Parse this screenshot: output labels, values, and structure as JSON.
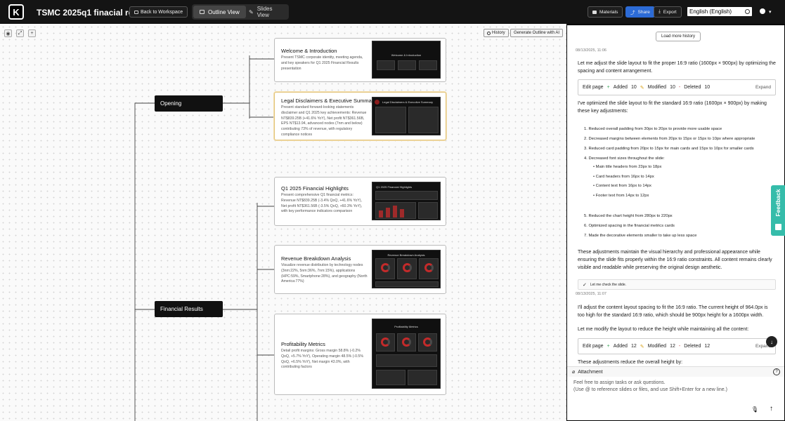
{
  "header": {
    "logo": "K",
    "title": "TSMC 2025q1 finacial report case",
    "back_label": "Back to Workspace",
    "outline_view": "Outline View",
    "slides_view": "Slides View",
    "materials": "Materials",
    "share": "Share",
    "export": "Export",
    "language": "English (English)"
  },
  "canvas": {
    "history": "History",
    "generate": "Generate Outline with AI",
    "sections": [
      {
        "label": "Opening"
      },
      {
        "label": "Financial Results"
      }
    ],
    "cards": [
      {
        "title": "Welcome & Introduction",
        "desc": "Present TSMC corporate identity, meeting agenda, and key speakers for Q1 2025 Financial Results presentation",
        "thumb_title": "Welcome & Introduction"
      },
      {
        "title": "Legal Disclaimers & Executive Summary",
        "desc": "Present standard forward-looking statements disclaimer and Q1 2025 key achievements: Revenue NT$839.25B (+41.6% YoY), Net profit NT$361.56B, EPS NT$13.94, advanced nodes (7nm and below) contributing 73% of revenue, with regulatory compliance notices",
        "thumb_title": "Legal Disclaimers & Executive Summary"
      },
      {
        "title": "Q1 2025 Financial Highlights",
        "desc": "Present comprehensive Q1 financial metrics: Revenue NT$839.25B (-3.4% QoQ, +41.6% YoY), Net profit NT$361.56B (-3.5% QoQ, +60.3% YoY), with key performance indicators comparison",
        "thumb_title": "Q1 2025 Financial Highlights"
      },
      {
        "title": "Revenue Breakdown Analysis",
        "desc": "Visualize revenue distribution by technology nodes (3nm:22%, 5nm:36%, 7nm:15%), applications (HPC:59%, Smartphone:28%), and geography (North America:77%)",
        "thumb_title": "Revenue Breakdown Analysis"
      },
      {
        "title": "Profitability Metrics",
        "desc": "Detail profit margins: Gross margin 58.8% (-0.2% QoQ, +5.7% YoY), Operating margin 48.5% (-0.5% QoQ, +6.5% YoY), Net margin 43.0%, with contributing factors",
        "thumb_title": "Profitability Metrics"
      }
    ]
  },
  "chat": {
    "load_more": "Load more history",
    "ts1": "08/13/2025, 11:06",
    "msg1": "Let me adjust the slide layout to fit the proper 16:9 ratio (1600px × 900px) by optimizing the spacing and content arrangement.",
    "edit1": {
      "label": "Edit page",
      "added": "Added",
      "added_n": "10",
      "modified": "Modified",
      "modified_n": "10",
      "deleted": "Deleted",
      "deleted_n": "10",
      "expand": "Expand"
    },
    "msg2": "I've optimized the slide layout to fit the standard 16:9 ratio (1600px × 900px) by making these key adjustments:",
    "list1": [
      "Reduced overall padding from 30px to 20px to provide more usable space",
      "Decreased margins between elements from 20px to 15px or 15px to 10px where appropriate",
      "Reduced card padding from 20px to 15px for main cards and 15px to 10px for smaller cards",
      "Decreased font sizes throughout the slide:"
    ],
    "sublist": [
      "Main title headers from 23px to 18px",
      "Card headers from 16px to 14px",
      "Content text from 16px to 14px",
      "Footer text from 14px to 12px"
    ],
    "list2": [
      "Reduced the chart height from 280px to 220px",
      "Optimized spacing in the financial metrics cards",
      "Made the decorative elements smaller to take up less space"
    ],
    "msg3": "These adjustments maintain the visual hierarchy and professional appearance while ensuring the slide fits properly within the 16:9 ratio constraints. All content remains clearly visible and readable while preserving the original design aesthetic.",
    "check": "Let me check the slide.",
    "ts2": "08/13/2025, 11:07",
    "msg4": "I'll adjust the content layout spacing to fit the 16:9 ratio. The current height of 964.0px is too high for the standard 16:9 ratio, which should be 900px height for a 1600px width.",
    "msg5": "Let me modify the layout to reduce the height while maintaining all the content:",
    "edit2": {
      "label": "Edit page",
      "added": "Added",
      "added_n": "12",
      "modified": "Modified",
      "modified_n": "12",
      "deleted": "Deleted",
      "deleted_n": "12",
      "expand": "Expand"
    },
    "msg6": "These adjustments reduce the overall height by:",
    "attachment": "Attachment",
    "placeholder_line1": "Feel free to assign tasks or ask questions.",
    "placeholder_line2": "(Use @ to reference slides or files, and use Shift+Enter for a new line.)",
    "feedback": "Feedback",
    "colors": {
      "added": "#2e9e4f",
      "modified": "#d9a21b",
      "deleted": "#c23b3b",
      "accent": "#2c6bd6",
      "feedback": "#35bcaa"
    }
  }
}
